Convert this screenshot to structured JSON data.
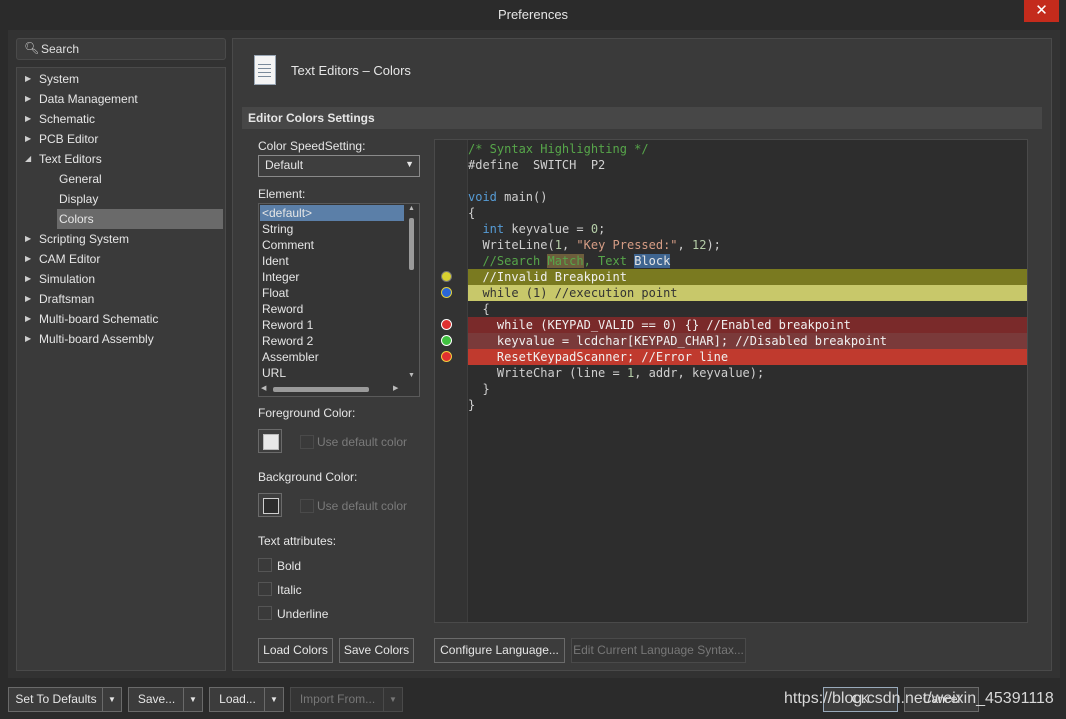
{
  "window": {
    "title": "Preferences",
    "close_glyph": "✕"
  },
  "search": {
    "placeholder": "Search",
    "icon": "search-icon"
  },
  "nav": {
    "items": [
      {
        "label": "System",
        "expanded": false
      },
      {
        "label": "Data Management",
        "expanded": false
      },
      {
        "label": "Schematic",
        "expanded": false
      },
      {
        "label": "PCB Editor",
        "expanded": false
      },
      {
        "label": "Text Editors",
        "expanded": true
      },
      {
        "label": "Scripting System",
        "expanded": false
      },
      {
        "label": "CAM Editor",
        "expanded": false
      },
      {
        "label": "Simulation",
        "expanded": false
      },
      {
        "label": "Draftsman",
        "expanded": false
      },
      {
        "label": "Multi-board Schematic",
        "expanded": false
      },
      {
        "label": "Multi-board Assembly",
        "expanded": false
      }
    ],
    "sub_items": [
      {
        "label": "General",
        "selected": false
      },
      {
        "label": "Display",
        "selected": false
      },
      {
        "label": "Colors",
        "selected": true
      }
    ]
  },
  "page": {
    "title": "Text Editors – Colors",
    "section": "Editor Colors Settings"
  },
  "speed_setting": {
    "label": "Color SpeedSetting:",
    "value": "Default"
  },
  "element": {
    "label": "Element:",
    "items": [
      "<default>",
      "String",
      "Comment",
      "Ident",
      "Integer",
      "Float",
      "Reword",
      "Reword 1",
      "Reword 2",
      "Assembler",
      "URL"
    ],
    "selected": "<default>"
  },
  "foreground": {
    "label": "Foreground Color:",
    "use_default": "Use default color",
    "color": "#e8e8e8"
  },
  "background": {
    "label": "Background Color:",
    "use_default": "Use default color",
    "color": "#2d2d2d"
  },
  "text_attributes": {
    "label": "Text attributes:",
    "bold": "Bold",
    "italic": "Italic",
    "underline": "Underline"
  },
  "code_preview": {
    "l0": "/* Syntax Highlighting */",
    "l1": "#define  SWITCH  P2",
    "l3a": "void",
    "l3b": " main()",
    "l4": "{",
    "l5a": "int",
    "l5b": " keyvalue = ",
    "l5c": "0",
    "l5d": ";",
    "l6a": "WriteLine(",
    "l6b": "1",
    "l6c": ", ",
    "l6d": "\"Key Pressed:\"",
    "l6e": ", ",
    "l6f": "12",
    "l6g": ");",
    "l7a": "//Search ",
    "l7b": "Match",
    "l7c": ", Text ",
    "l7d": "Block",
    "l8": "  //Invalid Breakpoint",
    "l9": "  while (1) //execution point",
    "l10": "  {",
    "l11": "    while (KEYPAD_VALID == 0) {} //Enabled breakpoint",
    "l12": "    keyvalue = lcdchar[KEYPAD_CHAR]; //Disabled breakpoint",
    "l13": "    ResetKeypadScanner; //Error line",
    "l14a": "WriteChar (line = ",
    "l14b": "1",
    "l14c": ", addr, keyvalue);",
    "l15": "  }",
    "l16": "}"
  },
  "buttons": {
    "load_colors": "Load Colors",
    "save_colors": "Save Colors",
    "configure_language": "Configure Language...",
    "edit_syntax": "Edit Current Language Syntax...",
    "set_defaults": "Set To Defaults",
    "save": "Save...",
    "load": "Load...",
    "import_from": "Import From...",
    "ok": "OK",
    "cancel": "Cancel"
  },
  "watermark": "https://blog.csdn.net/weixin_45391118",
  "colors": {
    "invalid_breakpoint": "#7a7a20",
    "execution_point": "#c8c86a",
    "enabled_breakpoint": "#7a2a2a",
    "disabled_breakpoint": "#7a3a3a",
    "error_line": "#c03a2e",
    "selection": "#5b7fa8"
  }
}
